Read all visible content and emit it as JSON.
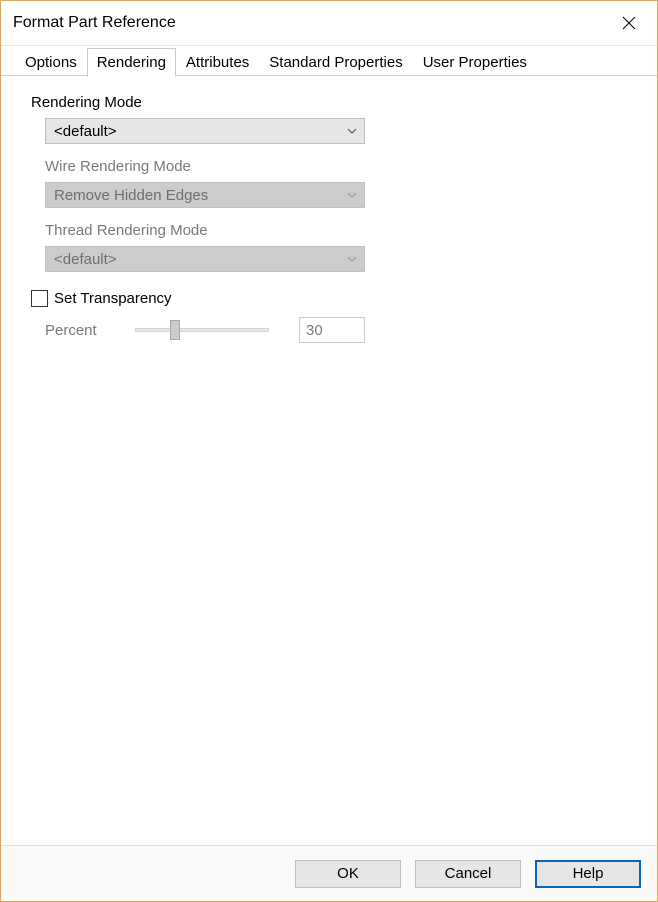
{
  "window": {
    "title": "Format Part Reference"
  },
  "tabs": {
    "options": "Options",
    "rendering": "Rendering",
    "attributes": "Attributes",
    "standard_properties": "Standard Properties",
    "user_properties": "User Properties"
  },
  "rendering": {
    "mode_label": "Rendering Mode",
    "mode_value": "<default>",
    "wire_label": "Wire Rendering Mode",
    "wire_value": "Remove Hidden Edges",
    "thread_label": "Thread Rendering Mode",
    "thread_value": "<default>",
    "set_transparency_label": "Set Transparency",
    "percent_label": "Percent",
    "percent_value": "30"
  },
  "buttons": {
    "ok": "OK",
    "cancel": "Cancel",
    "help": "Help"
  }
}
